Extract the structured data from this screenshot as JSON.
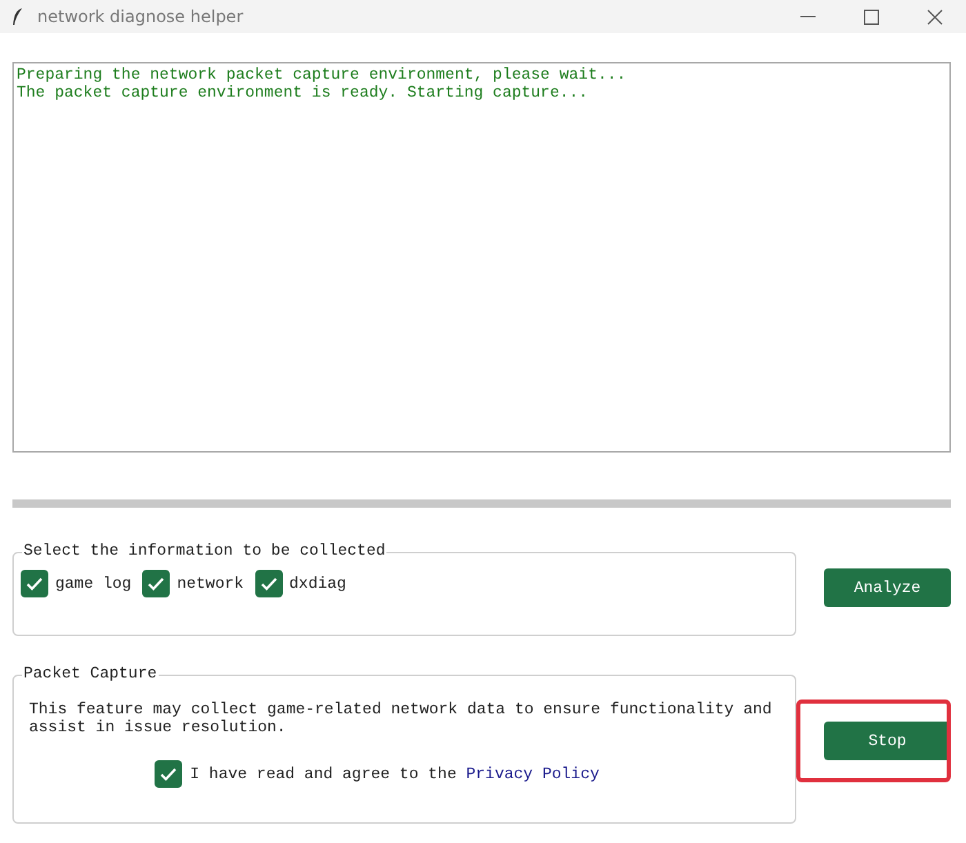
{
  "window": {
    "title": "network diagnose helper"
  },
  "log": {
    "lines": [
      "Preparing the network packet capture environment, please wait...",
      "The packet capture environment is ready. Starting capture..."
    ]
  },
  "collect": {
    "title": "Select the information to be collected",
    "options": [
      {
        "label": "game log",
        "checked": true
      },
      {
        "label": "network",
        "checked": true
      },
      {
        "label": "dxdiag",
        "checked": true
      }
    ],
    "button": "Analyze"
  },
  "capture": {
    "title": "Packet Capture",
    "notice": "This feature may collect game-related network data to ensure functionality and assist in issue resolution.",
    "agree": {
      "label": "I have read and agree to the ",
      "link": "Privacy Policy",
      "checked": true
    },
    "button": "Stop",
    "highlighted": true
  }
}
